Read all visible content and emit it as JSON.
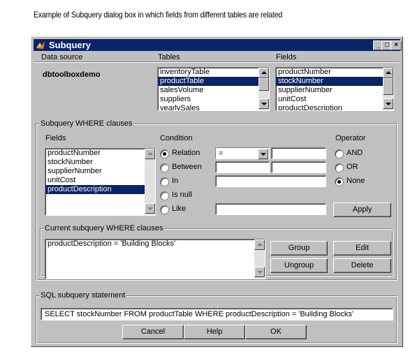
{
  "caption": "Example of Subquery dialog box in which fields from different tables are related",
  "window": {
    "title": "Subquery",
    "min_label": "_",
    "max_label": "□",
    "close_label": "×"
  },
  "data_source": {
    "label": "Data source",
    "value": "dbtoolboxdemo"
  },
  "tables": {
    "label": "Tables",
    "items": [
      "inventoryTable",
      "productTable",
      "salesVolume",
      "suppliers",
      "yearlySales"
    ],
    "selected": "productTable"
  },
  "fields": {
    "label": "Fields",
    "items": [
      "productNumber",
      "stockNumber",
      "supplierNumber",
      "unitCost",
      "productDescription"
    ],
    "selected": "stockNumber"
  },
  "where": {
    "group_label": "Subquery WHERE clauses",
    "fields_label": "Fields",
    "fields_items": [
      "productNumber",
      "stockNumber",
      "supplierNumber",
      "unitCost",
      "productDescription"
    ],
    "fields_selected": "productDescription",
    "condition_label": "Condition",
    "conditions": [
      "Relation",
      "Between",
      "In",
      "Is null",
      "Like"
    ],
    "condition_selected": "Relation",
    "relation_value": "=",
    "operator_label": "Operator",
    "operators": [
      "AND",
      "OR",
      "None"
    ],
    "operator_selected": "None",
    "apply_label": "Apply"
  },
  "current": {
    "group_label": "Current subquery WHERE clauses",
    "clause": "productDescription = 'Building Blocks'",
    "group_btn": "Group",
    "edit_btn": "Edit",
    "ungroup_btn": "Ungroup",
    "delete_btn": "Delete"
  },
  "sql": {
    "group_label": "SQL subquery statement",
    "statement": "SELECT stockNumber FROM productTable WHERE productDescription = 'Building Blocks'"
  },
  "buttons": {
    "cancel": "Cancel",
    "help": "Help",
    "ok": "OK"
  },
  "colors": {
    "dialog_bg": "#c0c0c0",
    "titlebar": "#0a246a",
    "selection": "#0a246a"
  }
}
